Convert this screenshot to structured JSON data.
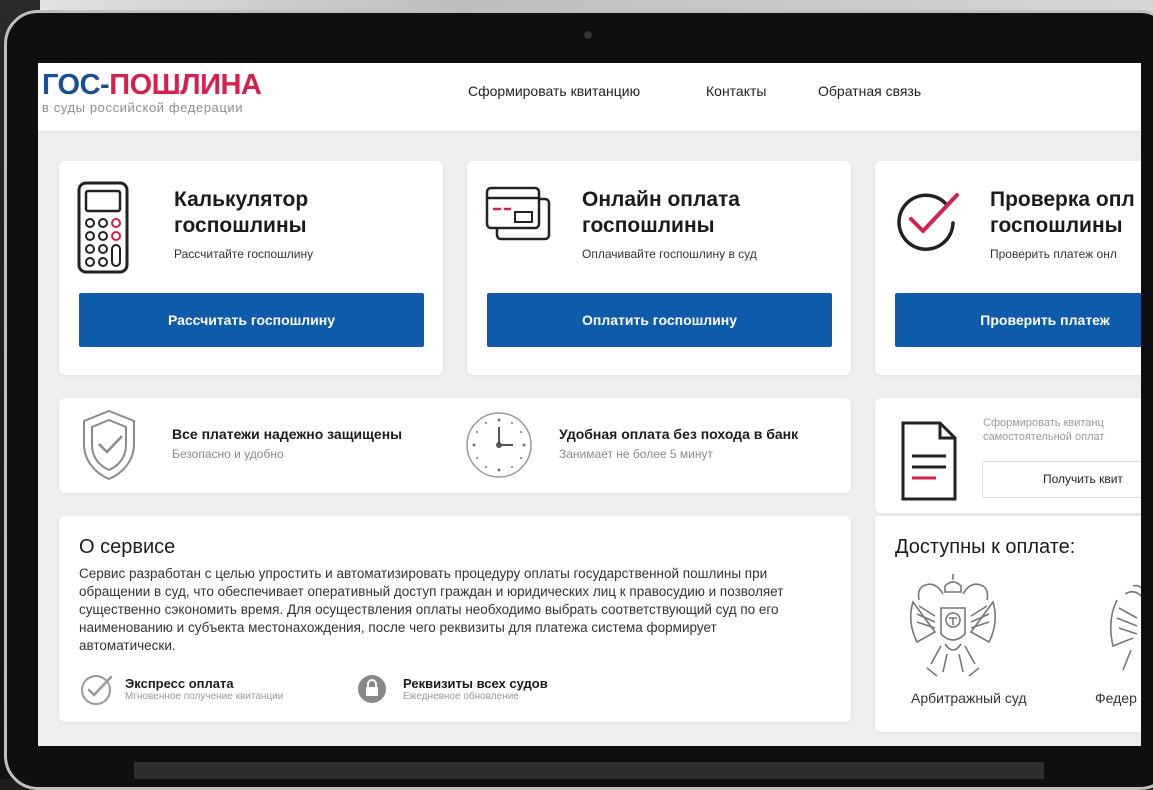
{
  "logo": {
    "part1": "ГОС-",
    "part2": "ПОШЛИНА",
    "tagline": "в суды российской федерации"
  },
  "nav": {
    "form_receipt": "Сформировать квитанцию",
    "contacts": "Контакты",
    "feedback": "Обратная связь"
  },
  "cards": [
    {
      "title": "Калькулятор госпошлины",
      "subtitle": "Рассчитайте госпошлину",
      "button": "Рассчитать госпошлину",
      "icon": "calculator-icon"
    },
    {
      "title": "Онлайн оплата госпошлины",
      "subtitle": "Оплачивайте госпошлину в суд",
      "button": "Оплатить госпошлину",
      "icon": "credit-card-icon"
    },
    {
      "title": "Проверка опл госпошлины",
      "subtitle": "Проверить платеж онл",
      "button": "Проверить платеж",
      "icon": "check-circle-icon"
    }
  ],
  "features": [
    {
      "title": "Все платежи надежно защищены",
      "subtitle": "Безопасно и удобно",
      "icon": "shield-check-icon"
    },
    {
      "title": "Удобная оплата без похода в банк",
      "subtitle": "Занимает не более 5 минут",
      "icon": "clock-icon"
    }
  ],
  "receipt": {
    "text": "Сформировать квитанц самостоятельной оплат",
    "button": "Получить квит",
    "icon": "document-icon"
  },
  "about": {
    "title": "О сервисе",
    "text": "Сервис разработан с целью упростить и автоматизировать процедуру оплаты государственной пошлины при обращении в суд, что обеспечивает оперативный доступ граждан и юридических лиц к правосудию и позволяет существенно сэкономить время. Для осуществления оплаты необходимо выбрать соответствующий суд по его наименованию и субъекта местонахождения, после чего реквизиты для платежа система формирует автоматически.",
    "express_title": "Экспресс оплата",
    "express_sub": "Мгновенное получение квитанции",
    "requisites_title": "Реквизиты всех судов",
    "requisites_sub": "Ежедневное обновление"
  },
  "available": {
    "title": "Доступны к оплате:",
    "courts": [
      "Арбитражный суд",
      "Федер"
    ]
  },
  "colors": {
    "brand_blue": "#1a4f96",
    "brand_red": "#d6204e",
    "button_blue": "#0e5ba9",
    "page_bg": "#eeeff1"
  }
}
